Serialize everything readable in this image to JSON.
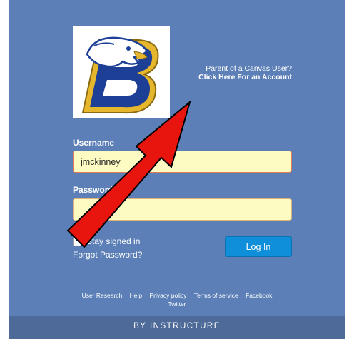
{
  "logo": {
    "alt": "Eagle B school logo",
    "colors": {
      "blue": "#1d3f95",
      "gold": "#e6b72c"
    }
  },
  "parent_link": {
    "line1": "Parent of a Canvas User?",
    "line2": "Click Here For an Account"
  },
  "form": {
    "username_label": "Username",
    "username_value": "jmckinney",
    "password_label": "Password",
    "password_value": "",
    "stay_signed_in_label": "Stay signed in",
    "forgot_password": "Forgot Password?",
    "login_button": "Log In"
  },
  "footer": {
    "links": [
      "User Research",
      "Help",
      "Privacy policy",
      "Terms of service",
      "Facebook",
      "Twitter"
    ],
    "brand": "BY INSTRUCTURE"
  },
  "colors": {
    "background": "#5b7fb6",
    "field_bg": "#fdfbc1",
    "button_bg": "#0f8ed9",
    "arrow_red": "#e8150f"
  },
  "annotation": {
    "icon": "red-arrow-icon"
  }
}
